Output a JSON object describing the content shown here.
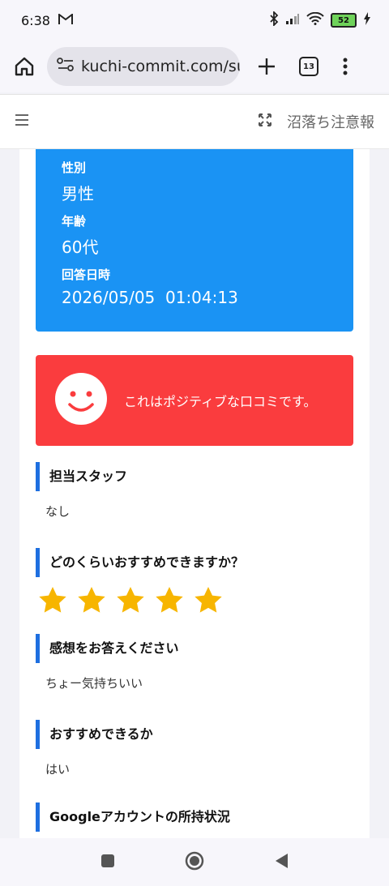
{
  "status_bar": {
    "time": "6:38",
    "mail_icon": "gmail-icon",
    "battery_level": "52"
  },
  "browser": {
    "url": "kuchi-commit.com/su",
    "tab_count": "13"
  },
  "site_header": {
    "title": "沼落ち注意報"
  },
  "profile": {
    "gender_label": "性別",
    "gender_value": "男性",
    "age_label": "年齢",
    "age_value": "60代",
    "date_label": "回答日時",
    "date_value": "2026/05/05  01:04:13"
  },
  "sentiment": {
    "text": "これはポジティブな口コミです。"
  },
  "questions": [
    {
      "heading": "担当スタッフ",
      "answer": "なし"
    },
    {
      "heading": "どのくらいおすすめできますか？",
      "rating": 5,
      "rating_max": 5
    },
    {
      "heading": "感想をお答えください",
      "answer": "ちょー気持ちいい"
    },
    {
      "heading": "おすすめできるか",
      "answer": "はい"
    },
    {
      "heading": "Googleアカウントの所持状況",
      "answer": ""
    }
  ],
  "colors": {
    "profile_blue": "#1a93f4",
    "positive_red": "#fa3c3e",
    "heading_bar": "#1e6fe0",
    "star": "#f7b500"
  }
}
